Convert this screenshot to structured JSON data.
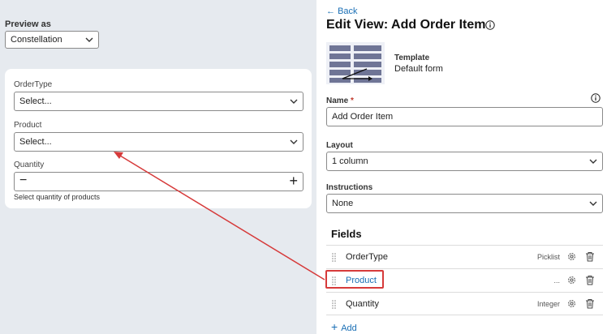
{
  "left": {
    "preview_label": "Preview as",
    "preview_value": "Constellation",
    "form": {
      "fields": [
        {
          "label": "OrderType",
          "placeholder": "Select..."
        },
        {
          "label": "Product",
          "placeholder": "Select..."
        }
      ],
      "quantity": {
        "label": "Quantity",
        "minus": "−",
        "plus": "+",
        "helper": "Select quantity of products"
      }
    }
  },
  "right": {
    "back_label": "Back",
    "title": "Edit View: Add Order Item",
    "template": {
      "label": "Template",
      "value": "Default form"
    },
    "name": {
      "label": "Name",
      "required_mark": "*",
      "value": "Add Order Item"
    },
    "layout": {
      "label": "Layout",
      "value": "1 column"
    },
    "instructions": {
      "label": "Instructions",
      "value": "None"
    },
    "fields_heading": "Fields",
    "fields": [
      {
        "name": "OrderType",
        "type": "Picklist"
      },
      {
        "name": "Product",
        "type": "..."
      },
      {
        "name": "Quantity",
        "type": "Integer"
      }
    ],
    "add_label": "Add"
  },
  "colors": {
    "accent": "#1a6fb5",
    "annotation": "#d63a3a",
    "left_bg": "#e6eaef"
  }
}
